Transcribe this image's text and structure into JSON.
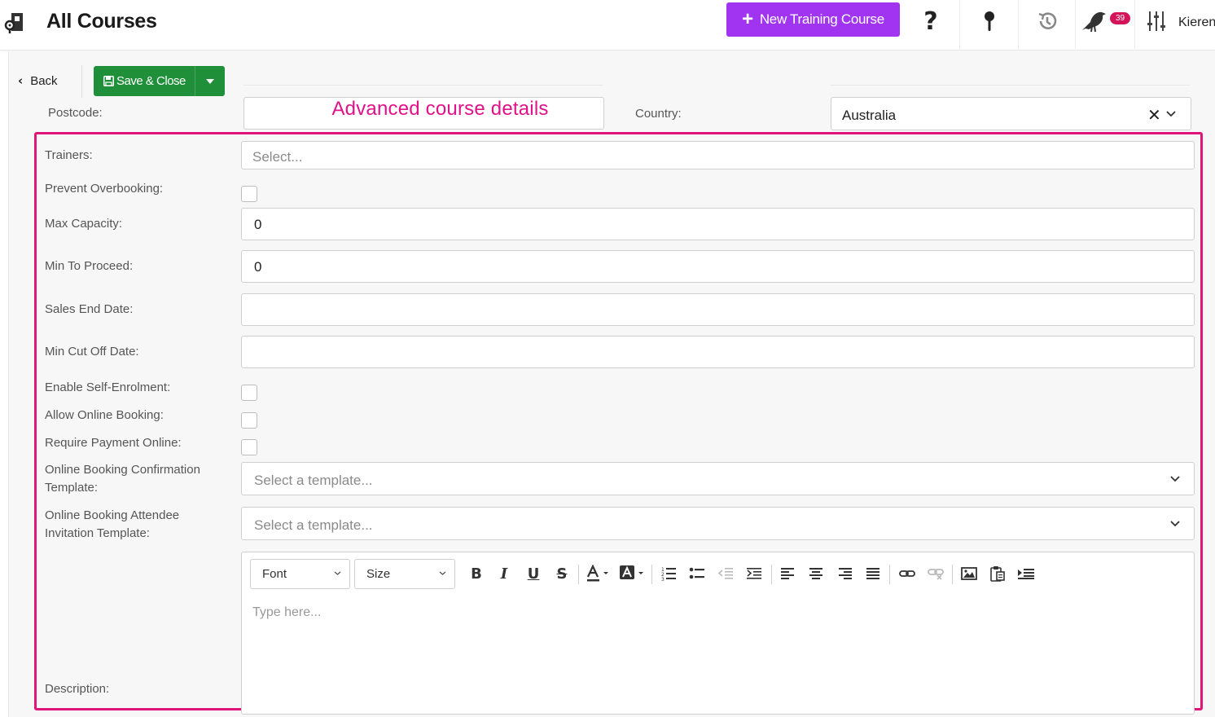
{
  "header": {
    "title": "All Courses",
    "new_button_label": "New Training Course",
    "help_symbol": "?",
    "notification_count": "39",
    "user_name": "Kieren"
  },
  "toolbar": {
    "back_label": "Back",
    "save_label": "Save & Close"
  },
  "location": {
    "postcode_label": "Postcode:",
    "country_label": "Country:",
    "country_value": "Australia",
    "clear_symbol": "✕"
  },
  "annotation": {
    "text": "Advanced course details",
    "color": "#e0128a"
  },
  "form": {
    "trainers_label": "Trainers:",
    "trainers_placeholder": "Select...",
    "prevent_overbooking_label": "Prevent Overbooking:",
    "max_capacity_label": "Max Capacity:",
    "max_capacity_value": "0",
    "min_to_proceed_label": "Min To Proceed:",
    "min_to_proceed_value": "0",
    "sales_end_date_label": "Sales End Date:",
    "min_cutoff_date_label": "Min Cut Off Date:",
    "self_enrolment_label": "Enable Self-Enrolment:",
    "online_booking_label": "Allow Online Booking:",
    "payment_online_label": "Require Payment Online:",
    "confirmation_template_label": "Online Booking Confirmation Template:",
    "confirmation_template_placeholder": "Select a template...",
    "invitation_template_label": "Online Booking Attendee Invitation Template:",
    "invitation_template_placeholder": "Select a template...",
    "description_label": "Description:"
  },
  "editor": {
    "font_label": "Font",
    "size_label": "Size",
    "bold": "B",
    "italic": "I",
    "underline": "U",
    "strike": "S",
    "placeholder": "Type here..."
  },
  "colors": {
    "primary_purple": "#a134f0",
    "save_green": "#1f8f3a",
    "highlight_pink": "#e0157a",
    "badge_red": "#d4145a"
  }
}
